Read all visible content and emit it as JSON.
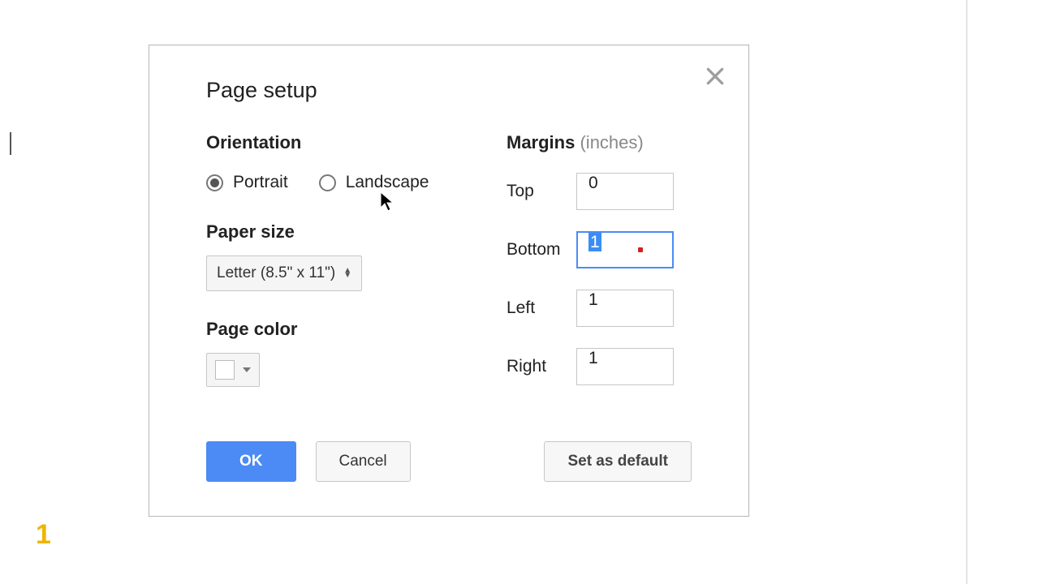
{
  "background": {
    "corner_number": "1"
  },
  "dialog": {
    "title": "Page setup",
    "orientation": {
      "label": "Orientation",
      "options": {
        "portrait": "Portrait",
        "landscape": "Landscape"
      },
      "selected": "portrait"
    },
    "paper_size": {
      "label": "Paper size",
      "value": "Letter (8.5\" x 11\")"
    },
    "page_color": {
      "label": "Page color",
      "value": "#ffffff"
    },
    "margins": {
      "label": "Margins",
      "unit": "(inches)",
      "top": {
        "label": "Top",
        "value": "0"
      },
      "bottom": {
        "label": "Bottom",
        "value": "1"
      },
      "left": {
        "label": "Left",
        "value": "1"
      },
      "right": {
        "label": "Right",
        "value": "1"
      }
    },
    "buttons": {
      "ok": "OK",
      "cancel": "Cancel",
      "set_default": "Set as default"
    }
  }
}
